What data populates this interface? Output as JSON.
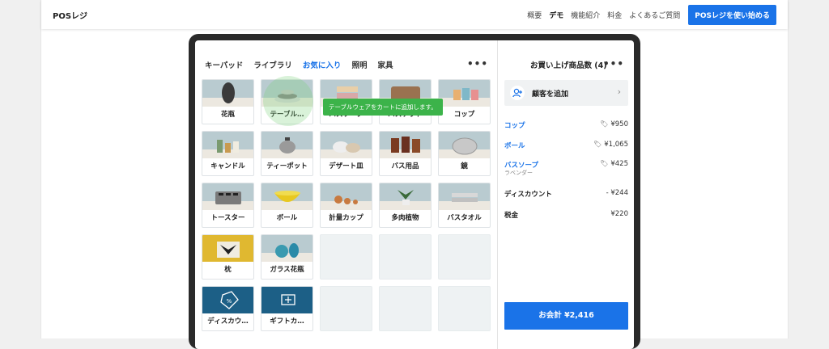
{
  "header": {
    "brand": "POSレジ",
    "nav": [
      "概要",
      "デモ",
      "機能紹介",
      "料金",
      "よくあるご質問"
    ],
    "active_nav": "デモ",
    "cta": "POSレジを使い始める",
    "accent": "#1a73e8"
  },
  "pos": {
    "tabs": [
      "キーパッド",
      "ライブラリ",
      "お気に入り",
      "照明",
      "家具"
    ],
    "active_tab": "お気に入り",
    "more_icon": "more-horizontal-icon",
    "tooltip": "テーブルウェアをカートに追加します。",
    "tiles": [
      {
        "label": "花瓶",
        "icon": "vase-image"
      },
      {
        "label": "テーブル…",
        "icon": "tableware-image"
      },
      {
        "label": "バスソープ",
        "icon": "bath-soap-image"
      },
      {
        "label": "バスケット",
        "icon": "basket-image"
      },
      {
        "label": "コップ",
        "icon": "cup-image"
      },
      {
        "label": "キャンドル",
        "icon": "candle-image"
      },
      {
        "label": "ティーポット",
        "icon": "teapot-image"
      },
      {
        "label": "デザート皿",
        "icon": "dessert-plate-image"
      },
      {
        "label": "バス用品",
        "icon": "bath-goods-image"
      },
      {
        "label": "鏡",
        "icon": "mirror-image"
      },
      {
        "label": "トースター",
        "icon": "toaster-image"
      },
      {
        "label": "ボール",
        "icon": "bowl-image"
      },
      {
        "label": "計量カップ",
        "icon": "measuring-cup-image"
      },
      {
        "label": "多肉植物",
        "icon": "succulent-image"
      },
      {
        "label": "バスタオル",
        "icon": "bath-towel-image"
      },
      {
        "label": "枕",
        "icon": "pillow-image"
      },
      {
        "label": "ガラス花瓶",
        "icon": "glass-vase-image"
      },
      {
        "label": "",
        "icon": ""
      },
      {
        "label": "",
        "icon": ""
      },
      {
        "label": "",
        "icon": ""
      },
      {
        "label": "ディスカウ…",
        "icon": "discount-tag-icon"
      },
      {
        "label": "ギフトカ…",
        "icon": "gift-card-icon"
      },
      {
        "label": "",
        "icon": ""
      },
      {
        "label": "",
        "icon": ""
      },
      {
        "label": "",
        "icon": ""
      }
    ]
  },
  "cart": {
    "title": "お買い上げ商品数 (4)",
    "add_customer": "顧客を追加",
    "items": [
      {
        "name": "コップ",
        "sub": "",
        "price": "¥950",
        "tag": true
      },
      {
        "name": "ボール",
        "sub": "",
        "price": "¥1,065",
        "tag": true
      },
      {
        "name": "バスソープ",
        "sub": "ラベンダー",
        "price": "¥425",
        "tag": true
      }
    ],
    "discount_label": "ディスカウント",
    "discount_value": "- ¥244",
    "tax_label": "税金",
    "tax_value": "¥220",
    "pay_button": "お会計 ¥2,416"
  }
}
